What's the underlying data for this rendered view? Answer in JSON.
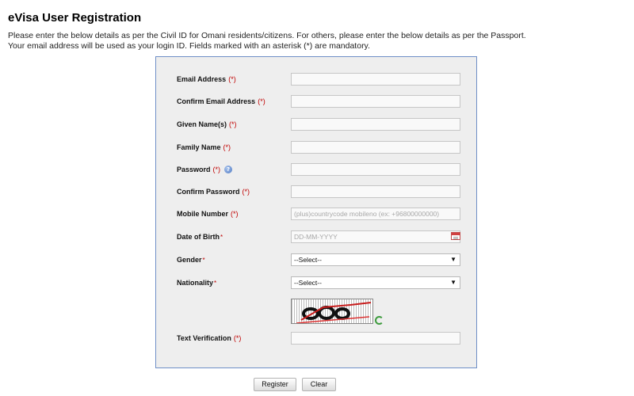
{
  "page": {
    "title": "eVisa User Registration",
    "intro_line1": "Please enter the below details as per the Civil ID for Omani residents/citizens. For others, please enter the below details as per the Passport.",
    "intro_line2": "Your email address will be used as your login ID. Fields marked with an asterisk (*) are mandatory."
  },
  "form": {
    "required_marker": "(*)",
    "star_marker": "*",
    "info_icon": "question-icon",
    "email_label": "Email Address",
    "confirm_email_label": "Confirm Email Address",
    "given_name_label": "Given Name(s)",
    "family_name_label": "Family Name",
    "password_label": "Password",
    "confirm_password_label": "Confirm Password",
    "mobile_label": "Mobile Number",
    "mobile_placeholder": "(plus)countrycode mobileno (ex: +96800000000)",
    "dob_label": "Date of Birth",
    "dob_placeholder": "DD-MM-YYYY",
    "gender_label": "Gender",
    "gender_selected": "--Select--",
    "nationality_label": "Nationality",
    "nationality_selected": "--Select--",
    "text_verification_label": "Text Verification"
  },
  "buttons": {
    "register": "Register",
    "clear": "Clear"
  }
}
